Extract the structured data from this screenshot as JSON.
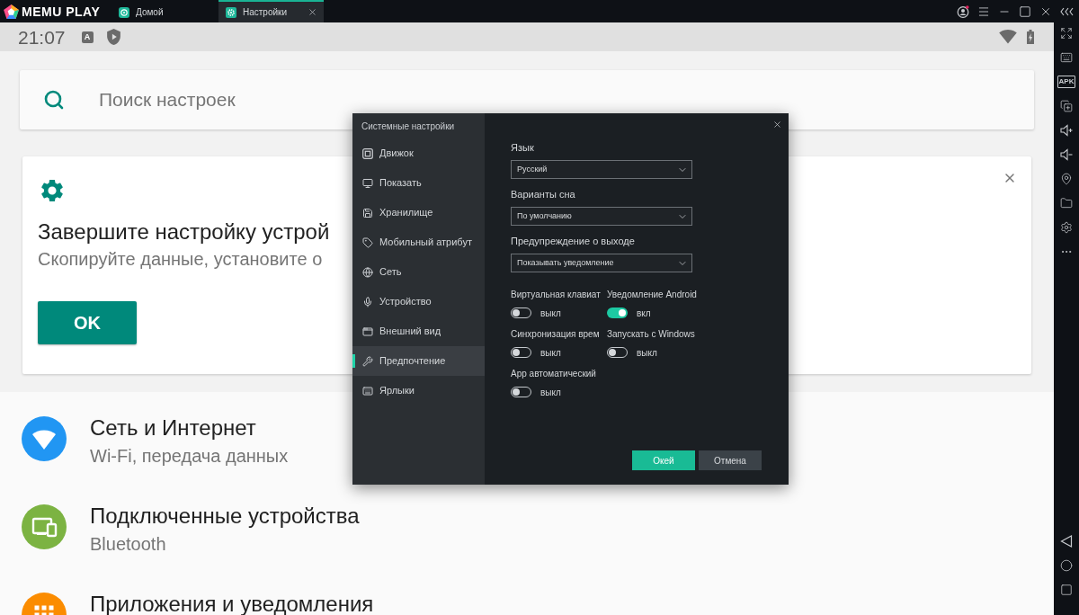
{
  "window": {
    "logo": "MEMU PLAY",
    "account_badge": true,
    "tabs": [
      {
        "label": "Домой",
        "kind": "home",
        "selected": false
      },
      {
        "label": "Настройки",
        "kind": "settings",
        "selected": true
      }
    ]
  },
  "status_bar": {
    "time": "21:07",
    "input_badge": "A"
  },
  "search": {
    "placeholder": "Поиск настроек"
  },
  "suggestion": {
    "title": "Завершите настройку устрой",
    "subtitle": "Скопируйте данные, установите о",
    "button": "OK"
  },
  "settings_list": [
    {
      "kind": "network",
      "color": "#2196f3",
      "title": "Сеть и Интернет",
      "subtitle": "Wi-Fi, передача данных"
    },
    {
      "kind": "devices",
      "color": "#7cb342",
      "title": "Подключенные устройства",
      "subtitle": "Bluetooth"
    },
    {
      "kind": "apps",
      "color": "#fb8c00",
      "title": "Приложения и уведомления"
    }
  ],
  "side_toolbar": {
    "apk_label": "APK"
  },
  "dialog": {
    "title": "Системные настройки",
    "nav": [
      {
        "label": "Движок",
        "kind": "engine",
        "selected": false
      },
      {
        "label": "Показать",
        "kind": "display",
        "selected": false
      },
      {
        "label": "Хранилище",
        "kind": "storage",
        "selected": false
      },
      {
        "label": "Мобильный атрибут",
        "kind": "mobile",
        "selected": false
      },
      {
        "label": "Сеть",
        "kind": "network",
        "selected": false
      },
      {
        "label": "Устройство",
        "kind": "device",
        "selected": false
      },
      {
        "label": "Внешний вид",
        "kind": "appearance",
        "selected": false
      },
      {
        "label": "Предпочтение",
        "kind": "preference",
        "selected": true
      },
      {
        "label": "Ярлыки",
        "kind": "shortcuts",
        "selected": false
      }
    ],
    "fields": [
      {
        "label": "Язык",
        "value": "Русский"
      },
      {
        "label": "Варианты сна",
        "value": "По умолчанию"
      },
      {
        "label": "Предупреждение о выходе",
        "value": "Показывать уведомление"
      }
    ],
    "toggles": [
      {
        "label": "Виртуальная клавиат",
        "on": false,
        "state_text": "выкл"
      },
      {
        "label": "Уведомление Android",
        "on": true,
        "state_text": "вкл"
      },
      {
        "label": "Синхронизация врем",
        "on": false,
        "state_text": "выкл"
      },
      {
        "label": "Запускать с Windows",
        "on": false,
        "state_text": "выкл"
      },
      {
        "label": "App автоматический",
        "on": false,
        "state_text": "выкл"
      }
    ],
    "buttons": [
      {
        "label": "Окей",
        "kind": "primary"
      },
      {
        "label": "Отмена",
        "kind": "secondary"
      }
    ]
  }
}
